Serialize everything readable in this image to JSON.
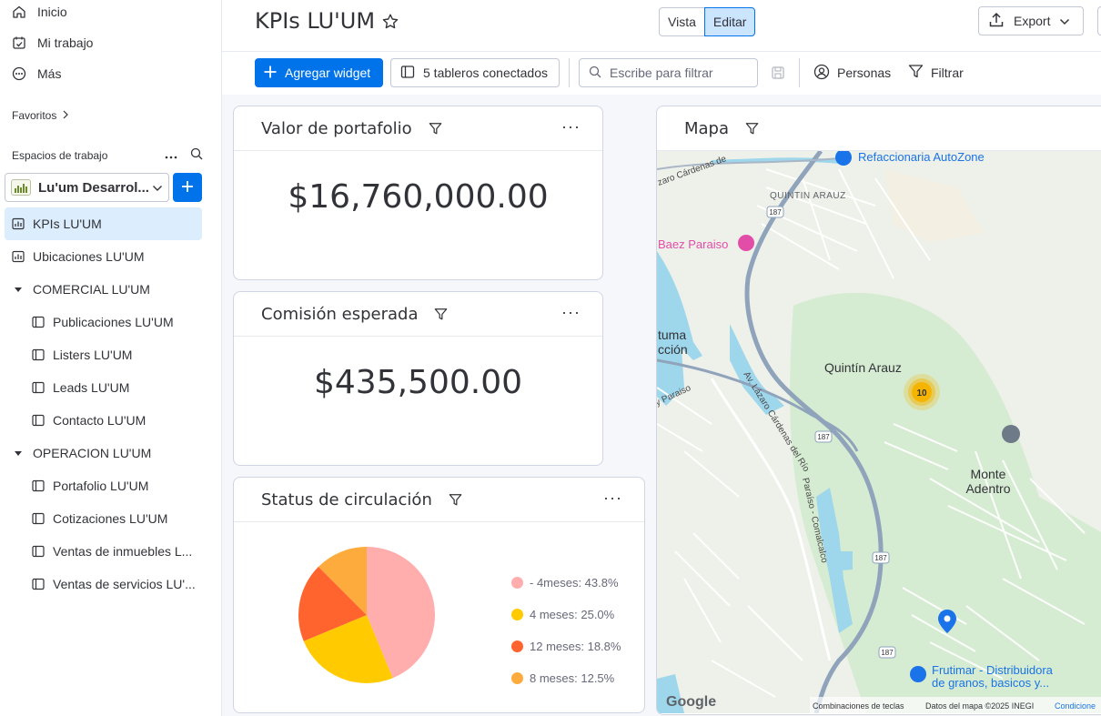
{
  "sidebar": {
    "nav": [
      {
        "label": "Inicio",
        "icon": "home-icon"
      },
      {
        "label": "Mi trabajo",
        "icon": "calendar-check-icon"
      },
      {
        "label": "Más",
        "icon": "more-circle-icon"
      }
    ],
    "favorites_label": "Favoritos",
    "workspaces_label": "Espacios de trabajo",
    "workspace_name": "Lu'um Desarrol...",
    "tree": [
      {
        "label": "KPIs LU'UM",
        "level": 0,
        "type": "dashboard",
        "active": true
      },
      {
        "label": "Ubicaciones LU'UM",
        "level": 0,
        "type": "dashboard"
      },
      {
        "label": "COMERCIAL LU'UM",
        "level": 0,
        "type": "folder"
      },
      {
        "label": "Publicaciones LU'UM",
        "level": 1,
        "type": "board"
      },
      {
        "label": "Listers LU'UM",
        "level": 1,
        "type": "board"
      },
      {
        "label": "Leads LU'UM",
        "level": 1,
        "type": "board"
      },
      {
        "label": "Contacto LU'UM",
        "level": 1,
        "type": "board"
      },
      {
        "label": "OPERACION LU'UM",
        "level": 0,
        "type": "folder"
      },
      {
        "label": "Portafolio LU'UM",
        "level": 1,
        "type": "board"
      },
      {
        "label": "Cotizaciones LU'UM",
        "level": 1,
        "type": "board"
      },
      {
        "label": "Ventas de inmuebles L...",
        "level": 1,
        "type": "board"
      },
      {
        "label": "Ventas de servicios LU'...",
        "level": 1,
        "type": "board"
      }
    ]
  },
  "header": {
    "title": "KPIs LU'UM",
    "view_label": "Vista",
    "edit_label": "Editar",
    "export_label": "Export"
  },
  "toolbar": {
    "add_widget_label": "Agregar widget",
    "boards_label": "5 tableros conectados",
    "filter_placeholder": "Escribe para filtrar",
    "people_label": "Personas",
    "filter_label": "Filtrar"
  },
  "widgets": {
    "portfolio": {
      "title": "Valor de portafolio",
      "value": "$16,760,000.00"
    },
    "commission": {
      "title": "Comisión esperada",
      "value": "$435,500.00"
    },
    "status": {
      "title": "Status de circulación"
    },
    "map": {
      "title": "Mapa",
      "labels": {
        "autozone": "Refaccionaria AutoZone",
        "quintin_caps": "QUINTIN ARAUZ",
        "baez": "Baez Paraiso",
        "tuma": "tuma",
        "accion": "cción",
        "quintin": "Quintín Arauz",
        "monte_1": "Monte",
        "monte_2": "Adentro",
        "frutimar_1": "Frutimar - Distribuidora",
        "frutimar_2": "de granos, basicos y...",
        "road_1": "Av. Lázaro Cárdenas del Río",
        "road_2": "Paraíso - Comalcalco",
        "road_3": "zaro Cárdenas de",
        "road_4": "y Paraiso",
        "shield": "187",
        "cluster_count": "10",
        "google": "Google",
        "shortcuts": "Combinaciones de teclas",
        "map_data": "Datos del mapa ©2025 INEGI",
        "conditions": "Condicione"
      }
    }
  },
  "chart_data": {
    "type": "pie",
    "categories": [
      "- 4meses",
      "4 meses",
      "12 meses",
      "8 meses"
    ],
    "values": [
      43.8,
      25.0,
      18.8,
      12.5
    ],
    "labels": [
      "- 4meses: 43.8%",
      "4 meses: 25.0%",
      "12 meses: 18.8%",
      "8 meses: 12.5%"
    ],
    "colors": [
      "#ffadad",
      "#ffcb00",
      "#ff642e",
      "#fdab3d"
    ],
    "legend_position": "right"
  },
  "colors": {
    "primary": "#0073ea",
    "active_bg": "#dcedfd",
    "map_water": "#9ed7ec",
    "map_green": "#d6ecd2",
    "map_road": "#8fa3bb",
    "cluster": "#f5b400",
    "pin_blue": "#1a73e8",
    "poi_pink": "#e24da8"
  }
}
